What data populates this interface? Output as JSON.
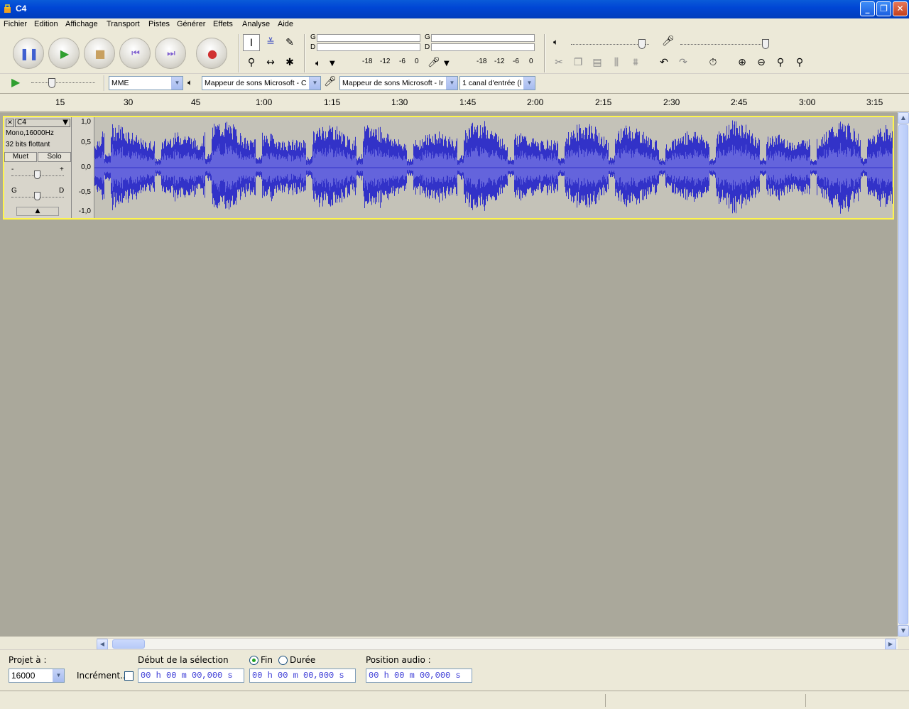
{
  "window": {
    "title": "C4"
  },
  "menu": [
    "Fichier",
    "Edition",
    "Affichage",
    "Transport",
    "Pistes",
    "Générer",
    "Effets",
    "Analyse",
    "Aide"
  ],
  "meter": {
    "left_label": "G",
    "right_label": "D",
    "scale": [
      "-18",
      "-12",
      "-6",
      "0"
    ]
  },
  "device": {
    "host": "MME",
    "output": "Mappeur de sons Microsoft - C",
    "input": "Mappeur de sons Microsoft - Ir",
    "channels": "1 canal d'entrée (I"
  },
  "ruler_ticks": [
    "15",
    "30",
    "45",
    "1:00",
    "1:15",
    "1:30",
    "1:45",
    "2:00",
    "2:15",
    "2:30",
    "2:45",
    "3:00",
    "3:15"
  ],
  "track": {
    "name": "C4",
    "format": "Mono,16000Hz",
    "bits": "32 bits flottant",
    "mute_label": "Muet",
    "solo_label": "Solo",
    "gain_minus": "-",
    "gain_plus": "+",
    "pan_left": "G",
    "pan_right": "D",
    "scale": [
      "1,0",
      "0,5",
      "0,0",
      "-0,5",
      "-1,0"
    ],
    "wave_color": "#3232c8"
  },
  "selection": {
    "project_rate_label": "Projet à :",
    "project_rate": "16000",
    "snap_label": "Incrément...",
    "start_label": "Début de la sélection",
    "end_option": "Fin",
    "length_option": "Durée",
    "audio_pos_label": "Position audio :",
    "start_value": "00 h 00 m 00,000 s",
    "end_value": "00 h 00 m 00,000 s",
    "pos_value": "00 h 00 m 00,000 s"
  }
}
